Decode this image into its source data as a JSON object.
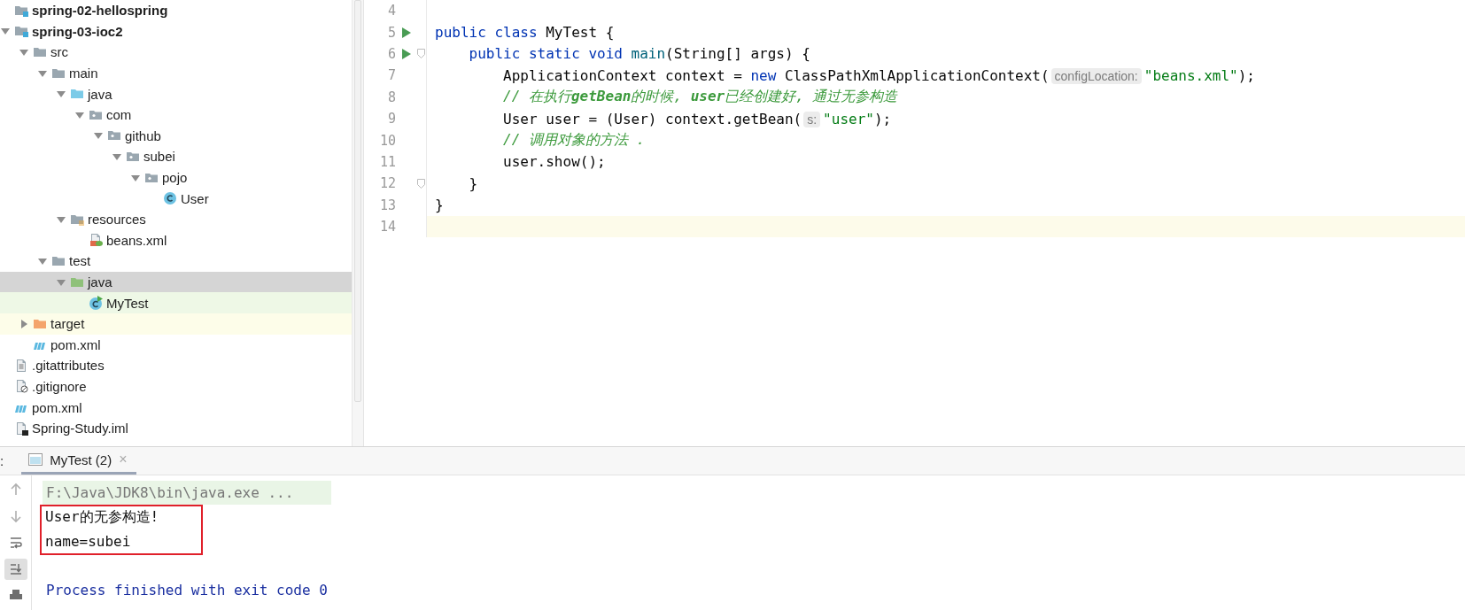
{
  "project_tree": {
    "items": [
      {
        "label": "spring-02-hellospring",
        "kind": "module",
        "selected": false,
        "open_in_editor": false
      },
      {
        "label": "spring-03-ioc2",
        "kind": "module",
        "expanded": true,
        "selected": false,
        "open_in_editor": false,
        "children": [
          {
            "label": "src",
            "kind": "folder",
            "expanded": true,
            "selected": false,
            "open_in_editor": false,
            "children": [
              {
                "label": "main",
                "kind": "folder",
                "expanded": true,
                "selected": false,
                "open_in_editor": false,
                "children": [
                  {
                    "label": "java",
                    "kind": "source",
                    "expanded": true,
                    "selected": false,
                    "open_in_editor": false,
                    "children": [
                      {
                        "label": "com",
                        "kind": "package",
                        "expanded": true,
                        "selected": false,
                        "open_in_editor": false,
                        "children": [
                          {
                            "label": "github",
                            "kind": "package",
                            "expanded": true,
                            "selected": false,
                            "open_in_editor": false,
                            "children": [
                              {
                                "label": "subei",
                                "kind": "package",
                                "expanded": true,
                                "selected": false,
                                "open_in_editor": false,
                                "children": [
                                  {
                                    "label": "pojo",
                                    "kind": "package",
                                    "expanded": true,
                                    "selected": false,
                                    "open_in_editor": false,
                                    "children": [
                                      {
                                        "label": "User",
                                        "kind": "class",
                                        "selected": false,
                                        "open_in_editor": false
                                      }
                                    ]
                                  }
                                ]
                              }
                            ]
                          }
                        ]
                      }
                    ]
                  },
                  {
                    "label": "resources",
                    "kind": "resources",
                    "expanded": true,
                    "selected": false,
                    "open_in_editor": false,
                    "children": [
                      {
                        "label": "beans.xml",
                        "kind": "xml",
                        "selected": false,
                        "open_in_editor": false
                      }
                    ]
                  }
                ]
              },
              {
                "label": "test",
                "kind": "folder",
                "expanded": true,
                "selected": false,
                "open_in_editor": false,
                "children": [
                  {
                    "label": "java",
                    "kind": "test",
                    "expanded": true,
                    "selected": true,
                    "open_in_editor": false,
                    "children": [
                      {
                        "label": "MyTest",
                        "kind": "runclass",
                        "selected": false,
                        "open_in_editor": true
                      }
                    ]
                  }
                ]
              }
            ]
          },
          {
            "label": "target",
            "kind": "excluded",
            "expanded": false,
            "selected": false,
            "open_in_editor": false
          },
          {
            "label": "pom.xml",
            "kind": "maven",
            "selected": false,
            "open_in_editor": false
          }
        ]
      },
      {
        "label": ".gitattributes",
        "kind": "text",
        "selected": false,
        "open_in_editor": false
      },
      {
        "label": ".gitignore",
        "kind": "ignore",
        "selected": false,
        "open_in_editor": false
      },
      {
        "label": "pom.xml",
        "kind": "maven",
        "selected": false,
        "open_in_editor": false
      },
      {
        "label": "Spring-Study.iml",
        "kind": "iml",
        "selected": false,
        "open_in_editor": false
      }
    ]
  },
  "editor": {
    "lines": [
      {
        "number": "4",
        "run": false,
        "fold": false,
        "current": false
      },
      {
        "number": "5",
        "run": true,
        "fold": false,
        "current": false,
        "segments": [
          {
            "kind": "keyword",
            "text": "public class"
          },
          {
            "kind": "plain",
            "text": " MyTest {"
          }
        ]
      },
      {
        "number": "6",
        "run": true,
        "fold": true,
        "current": false,
        "segments": [
          {
            "kind": "keyword",
            "text": "    public static void"
          },
          {
            "kind": "method",
            "text": " main"
          },
          {
            "kind": "plain",
            "text": "(String[] args) {"
          }
        ]
      },
      {
        "number": "7",
        "run": false,
        "fold": false,
        "current": false,
        "segments": [
          {
            "kind": "plain",
            "text": "        ApplicationContext context = "
          },
          {
            "kind": "keyword",
            "text": "new"
          },
          {
            "kind": "plain",
            "text": " ClassPathXmlApplicationContext("
          },
          {
            "kind": "hint",
            "text": "configLocation:"
          },
          {
            "kind": "string",
            "text": "\"beans.xml\""
          },
          {
            "kind": "plain",
            "text": ");"
          }
        ]
      },
      {
        "number": "8",
        "run": false,
        "fold": false,
        "current": false,
        "segments": [
          {
            "kind": "comment",
            "text": "        // 在执行**getBean**的时候, **user**已经创建好, 通过无参构造"
          }
        ]
      },
      {
        "number": "9",
        "run": false,
        "fold": false,
        "current": false,
        "segments": [
          {
            "kind": "plain",
            "text": "        User user = (User) context.getBean("
          },
          {
            "kind": "hint",
            "text": "s:"
          },
          {
            "kind": "string",
            "text": "\"user\""
          },
          {
            "kind": "plain",
            "text": ");"
          }
        ]
      },
      {
        "number": "10",
        "run": false,
        "fold": false,
        "current": false,
        "segments": [
          {
            "kind": "comment",
            "text": "        // 调用对象的方法 ."
          }
        ]
      },
      {
        "number": "11",
        "run": false,
        "fold": false,
        "current": false,
        "segments": [
          {
            "kind": "plain",
            "text": "        user.show();"
          }
        ]
      },
      {
        "number": "12",
        "run": false,
        "fold": true,
        "current": false,
        "segments": [
          {
            "kind": "plain",
            "text": "    }"
          }
        ]
      },
      {
        "number": "13",
        "run": false,
        "fold": false,
        "current": false,
        "segments": [
          {
            "kind": "plain",
            "text": "}"
          }
        ]
      },
      {
        "number": "14",
        "run": false,
        "fold": false,
        "current": true
      }
    ]
  },
  "run_panel": {
    "label": ":",
    "tabs": [
      {
        "label": "MyTest (2)",
        "close": "×",
        "selected": true
      }
    ],
    "toolbar": [
      {
        "kind": "up",
        "selected": false
      },
      {
        "kind": "down",
        "selected": false
      },
      {
        "kind": "wrap",
        "selected": false
      },
      {
        "kind": "scroll-end",
        "selected": true
      },
      {
        "kind": "print",
        "selected": false
      }
    ],
    "console": [
      {
        "kind": "command",
        "text": "F:\\Java\\JDK8\\bin\\java.exe ...",
        "boxed": false
      },
      {
        "kind": "output",
        "text": "User的无参构造!",
        "boxed": true
      },
      {
        "kind": "output",
        "text": "name=subei",
        "boxed": true
      },
      {
        "kind": "blank",
        "boxed": false
      },
      {
        "kind": "exit",
        "text": "Process finished with exit code 0",
        "boxed": false
      }
    ]
  }
}
